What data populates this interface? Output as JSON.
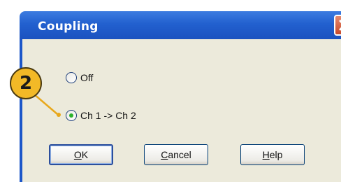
{
  "dialog": {
    "title": "Coupling",
    "close_icon": "close-icon"
  },
  "options": [
    {
      "label": "Off",
      "checked": false
    },
    {
      "label": "Ch 1 -> Ch 2",
      "checked": true
    }
  ],
  "buttons": {
    "ok_label_rest": "K",
    "ok_label_underlined": "O",
    "cancel_label_rest": "ancel",
    "cancel_label_underlined": "C",
    "help_label_rest": "elp",
    "help_label_underlined": "H"
  },
  "callout": {
    "number": "2",
    "color": "#f2b927"
  }
}
